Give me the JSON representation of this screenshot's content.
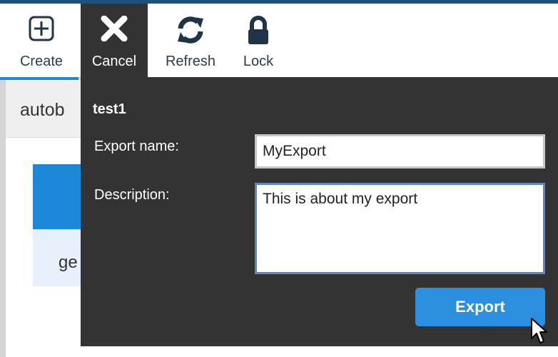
{
  "toolbar": {
    "create_label": "Create",
    "cancel_label": "Cancel",
    "refresh_label": "Refresh",
    "lock_label": "Lock",
    "icons": {
      "create": "plus-square-icon",
      "cancel": "x-icon",
      "refresh": "refresh-icon",
      "lock": "lock-icon"
    }
  },
  "background": {
    "subheader_text": "autob",
    "card_text": "ge"
  },
  "dialog": {
    "title": "test1",
    "export_name_label": "Export name:",
    "export_name_value": "MyExport",
    "description_label": "Description:",
    "description_value": "This is about my export",
    "export_button_label": "Export"
  },
  "colors": {
    "accent": "#1d87d9",
    "dialog_bg": "#333333",
    "button": "#2b8fe0",
    "toolbar_text": "#2a3e50"
  }
}
